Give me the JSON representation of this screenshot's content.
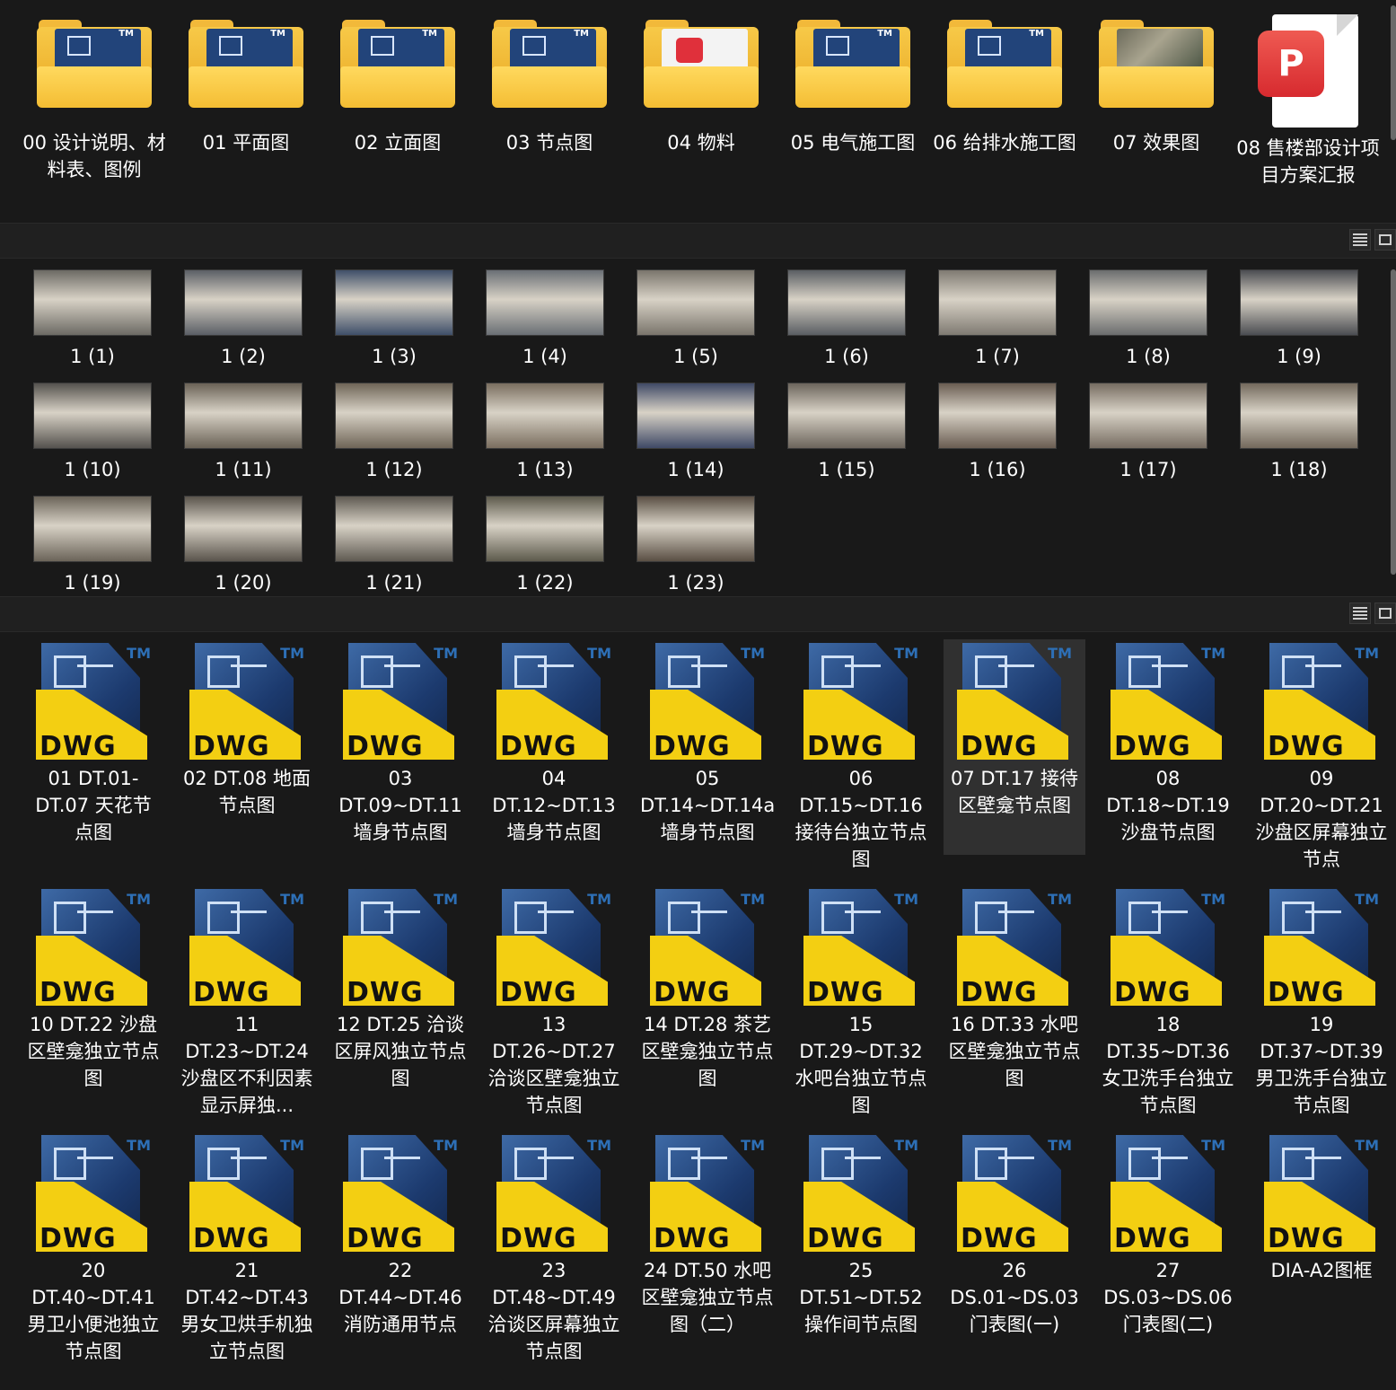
{
  "folders": [
    {
      "label": "00  设计说明、材料表、图例",
      "kind": "cad"
    },
    {
      "label": "01  平面图",
      "kind": "cad"
    },
    {
      "label": "02  立面图",
      "kind": "cad"
    },
    {
      "label": "03  节点图",
      "kind": "cad"
    },
    {
      "label": "04  物料",
      "kind": "wps"
    },
    {
      "label": "05  电气施工图",
      "kind": "cad"
    },
    {
      "label": "06  给排水施工图",
      "kind": "cad"
    },
    {
      "label": "07  效果图",
      "kind": "image"
    }
  ],
  "pdf_file": {
    "label": "08  售楼部设计项目方案汇报",
    "badge": "P"
  },
  "images": [
    {
      "label": "1 (1)",
      "color": "#6c6a64"
    },
    {
      "label": "1 (2)",
      "color": "#5b5f66"
    },
    {
      "label": "1 (3)",
      "color": "#3f4f69"
    },
    {
      "label": "1 (4)",
      "color": "#6a6f75"
    },
    {
      "label": "1 (5)",
      "color": "#7a756c"
    },
    {
      "label": "1 (6)",
      "color": "#5a5e63"
    },
    {
      "label": "1 (7)",
      "color": "#7f7a72"
    },
    {
      "label": "1 (8)",
      "color": "#6b6d6e"
    },
    {
      "label": "1 (9)",
      "color": "#4b4d52"
    },
    {
      "label": "1 (10)",
      "color": "#55524e"
    },
    {
      "label": "1 (11)",
      "color": "#6a6256"
    },
    {
      "label": "1 (12)",
      "color": "#6f6557"
    },
    {
      "label": "1 (13)",
      "color": "#7a6e5f"
    },
    {
      "label": "1 (14)",
      "color": "#3f4966"
    },
    {
      "label": "1 (15)",
      "color": "#6c655c"
    },
    {
      "label": "1 (16)",
      "color": "#6a5d52"
    },
    {
      "label": "1 (17)",
      "color": "#766c61"
    },
    {
      "label": "1 (18)",
      "color": "#73695c"
    },
    {
      "label": "1 (19)",
      "color": "#6b6459"
    },
    {
      "label": "1 (20)",
      "color": "#5a544c"
    },
    {
      "label": "1 (21)",
      "color": "#5f5a52"
    },
    {
      "label": "1 (22)",
      "color": "#5d5a4c"
    },
    {
      "label": "1 (23)",
      "color": "#5a4f44"
    }
  ],
  "dwg_icon_text": "DWG",
  "dwg_tm": "TM",
  "dwg_files": [
    {
      "label": "01 DT.01-DT.07 天花节点图"
    },
    {
      "label": "02 DT.08 地面节点图"
    },
    {
      "label": "03 DT.09~DT.11 墙身节点图"
    },
    {
      "label": "04 DT.12~DT.13 墙身节点图"
    },
    {
      "label": "05 DT.14~DT.14a 墙身节点图"
    },
    {
      "label": "06 DT.15~DT.16 接待台独立节点图"
    },
    {
      "label": "07 DT.17 接待区壁龛节点图",
      "selected": true
    },
    {
      "label": "08 DT.18~DT.19 沙盘节点图"
    },
    {
      "label": "09 DT.20~DT.21 沙盘区屏幕独立节点"
    },
    {
      "label": "10 DT.22 沙盘区壁龛独立节点图"
    },
    {
      "label": "11 DT.23~DT.24 沙盘区不利因素显示屏独..."
    },
    {
      "label": "12 DT.25 洽谈区屏风独立节点图"
    },
    {
      "label": "13 DT.26~DT.27 洽谈区壁龛独立节点图"
    },
    {
      "label": "14 DT.28 茶艺区壁龛独立节点图"
    },
    {
      "label": "15 DT.29~DT.32 水吧台独立节点图"
    },
    {
      "label": "16 DT.33 水吧区壁龛独立节点图"
    },
    {
      "label": "18 DT.35~DT.36 女卫洗手台独立节点图"
    },
    {
      "label": "19 DT.37~DT.39 男卫洗手台独立节点图"
    },
    {
      "label": "20 DT.40~DT.41 男卫小便池独立节点图"
    },
    {
      "label": "21 DT.42~DT.43 男女卫烘手机独立节点图"
    },
    {
      "label": "22 DT.44~DT.46 消防通用节点"
    },
    {
      "label": "23 DT.48~DT.49 洽谈区屏幕独立节点图"
    },
    {
      "label": "24 DT.50 水吧区壁龛独立节点图（二）"
    },
    {
      "label": "25 DT.51~DT.52 操作间节点图"
    },
    {
      "label": "26 DS.01~DS.03 门表图(一)"
    },
    {
      "label": "27 DS.03~DS.06 门表图(二)"
    },
    {
      "label": "DIA-A2图框"
    }
  ]
}
